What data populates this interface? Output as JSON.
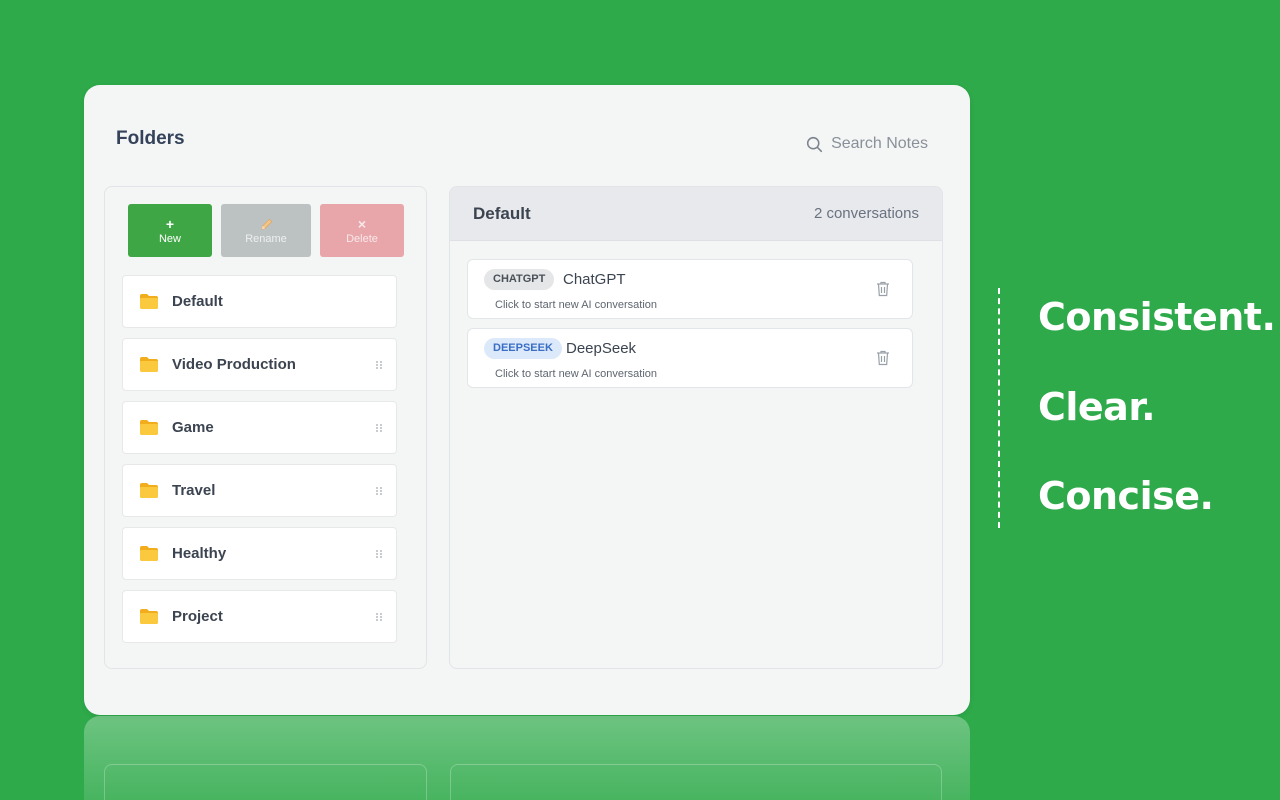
{
  "panel": {
    "title": "Folders",
    "search_placeholder": "Search Notes"
  },
  "toolbar": {
    "new_symbol": "+",
    "new_label": "New",
    "rename_label": "Rename",
    "delete_symbol": "×",
    "delete_label": "Delete"
  },
  "folders": [
    {
      "name": "Default"
    },
    {
      "name": "Video Production"
    },
    {
      "name": "Game"
    },
    {
      "name": "Travel"
    },
    {
      "name": "Healthy"
    },
    {
      "name": "Project"
    }
  ],
  "selected_folder": {
    "title": "Default",
    "count": "2 conversations"
  },
  "conversations": [
    {
      "badge": "CHATGPT",
      "name": "ChatGPT",
      "subtitle": "Click to start new AI conversation"
    },
    {
      "badge": "DEEPSEEK",
      "name": "DeepSeek",
      "subtitle": "Click to start new AI conversation"
    }
  ],
  "taglines": [
    "Consistent.",
    "Clear.",
    "Concise."
  ],
  "colors": {
    "background": "#2eaa4a",
    "new_button": "#3fa645",
    "rename_button": "#bcc1c2",
    "delete_button": "#e8a6ab",
    "folder_icon": "#f7b928"
  }
}
